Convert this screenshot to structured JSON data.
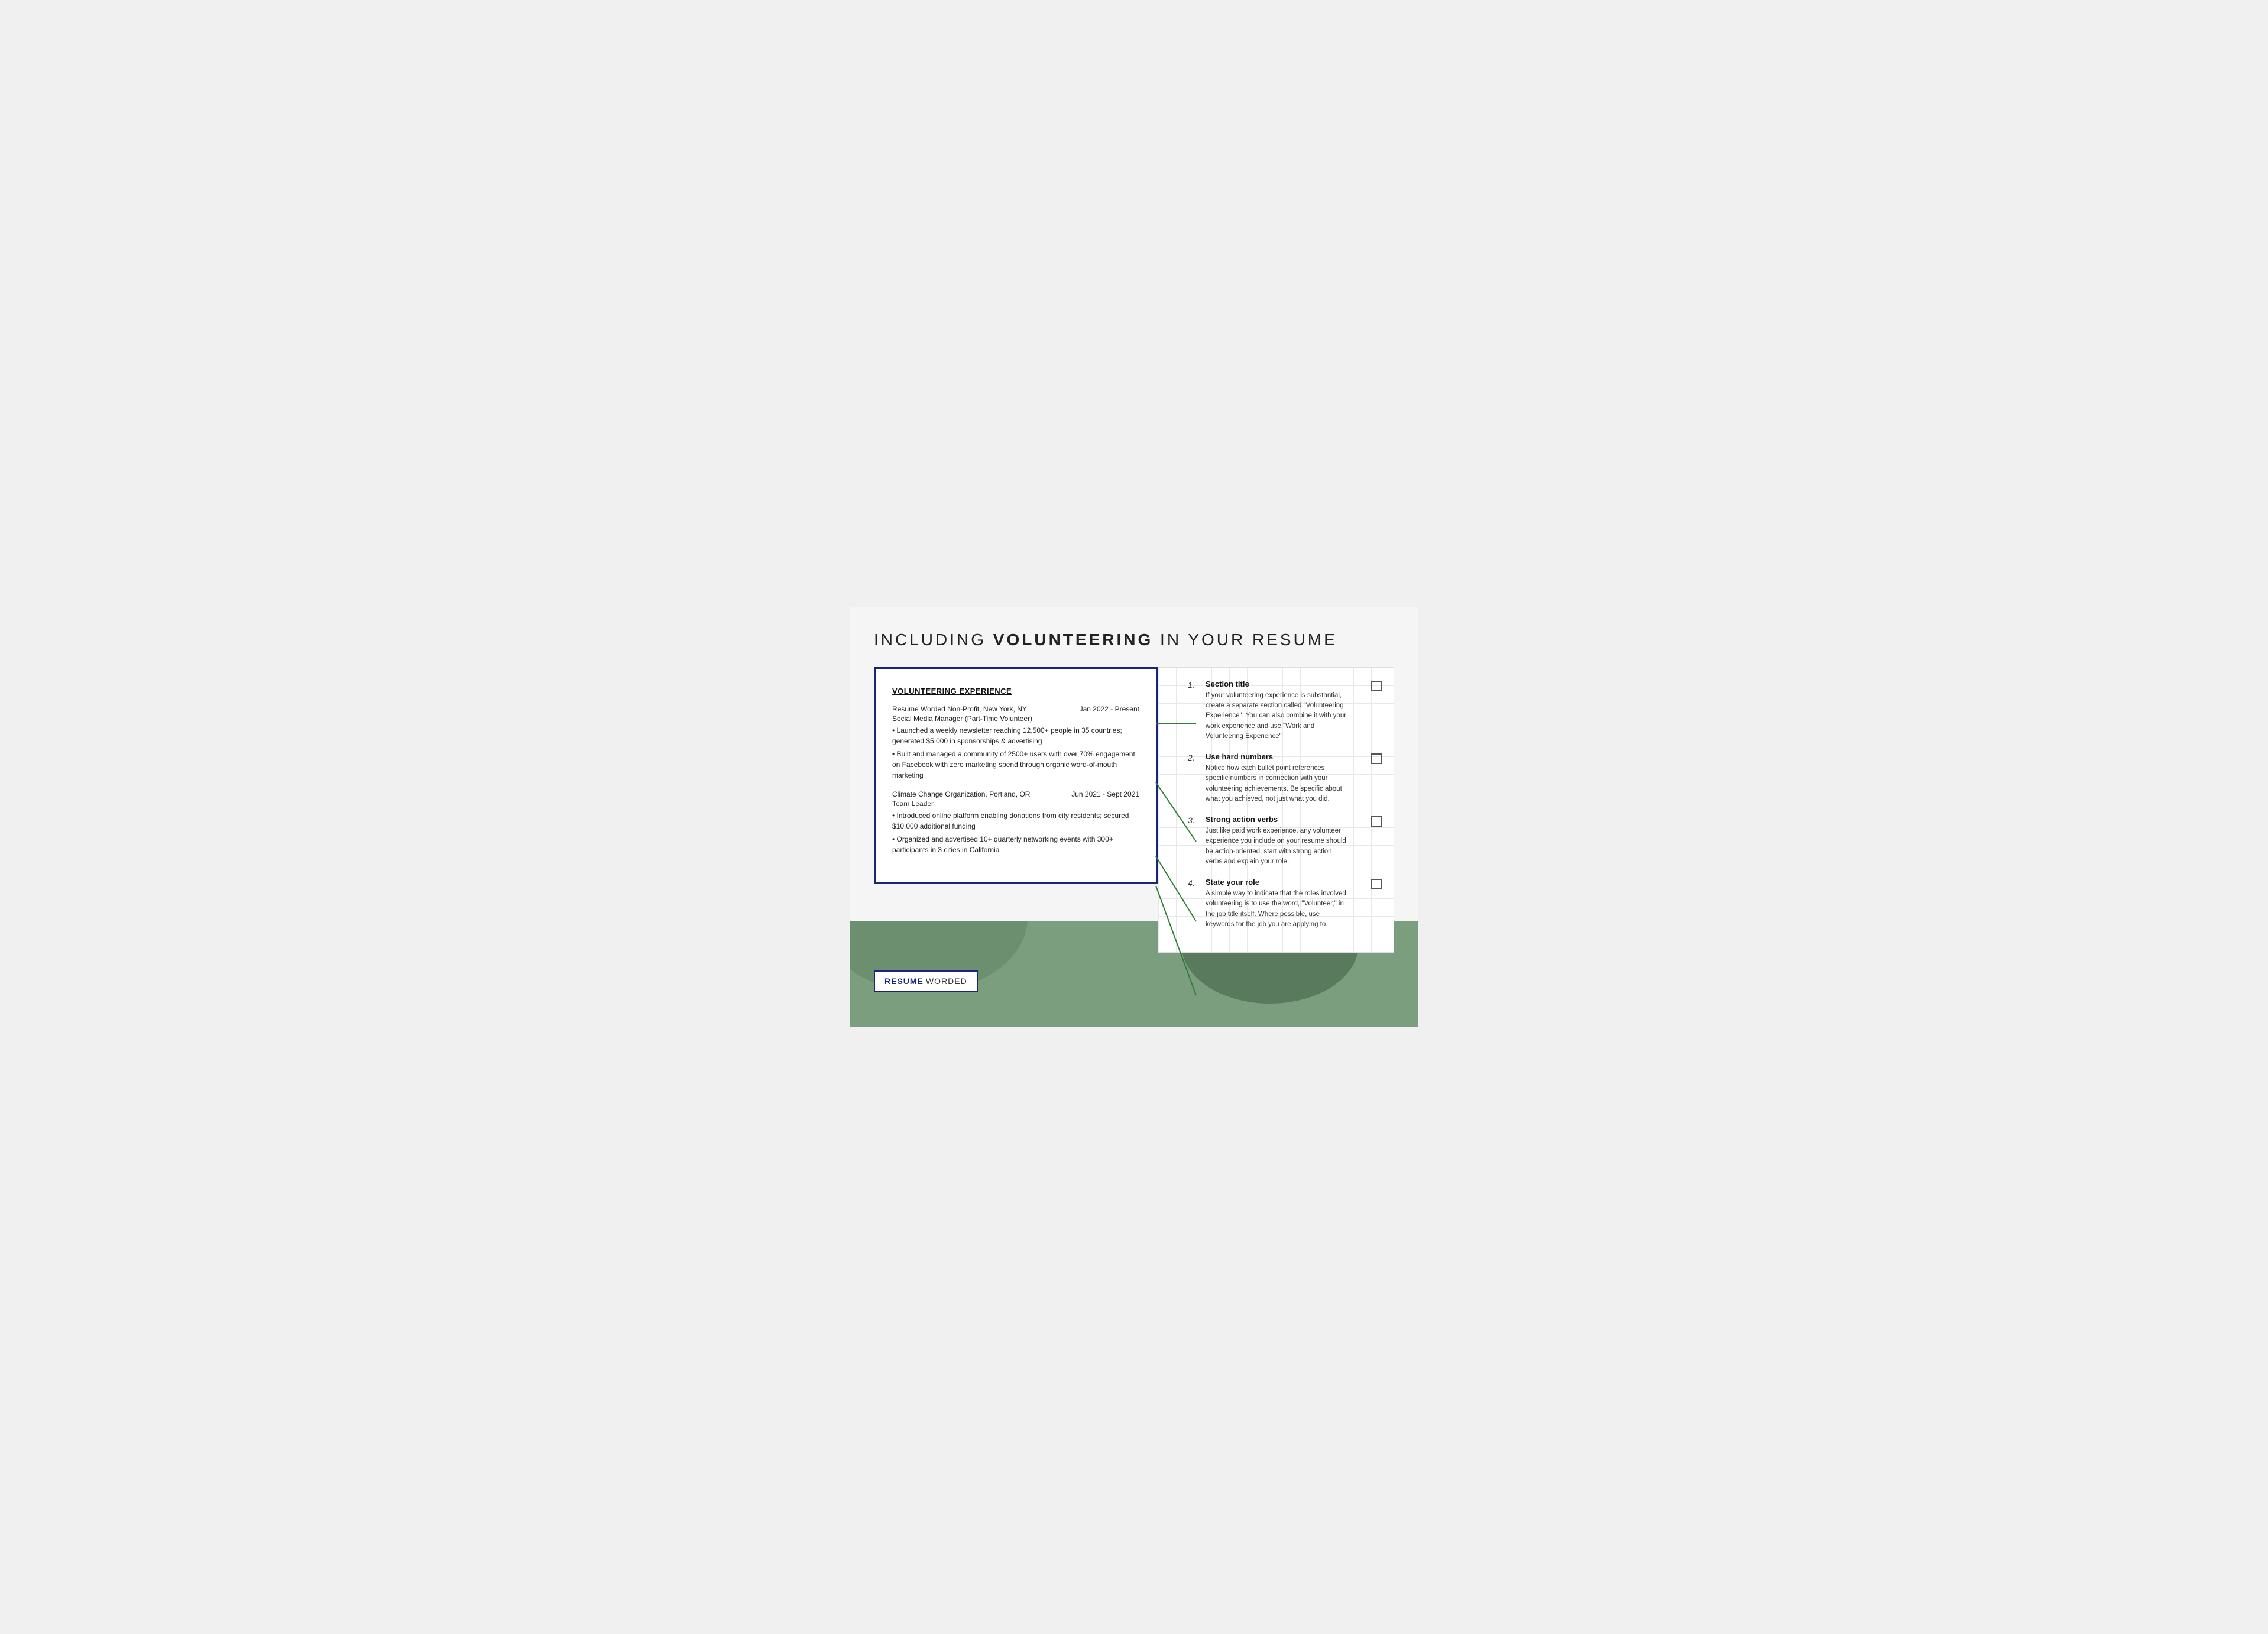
{
  "title": {
    "prefix": "INCLUDING ",
    "bold": "VOLUNTEERING",
    "suffix": " IN YOUR RESUME"
  },
  "resume": {
    "section_title": "VOLUNTEERING EXPERIENCE",
    "entries": [
      {
        "org": "Resume Worded Non-Profit, New York, NY",
        "date": "Jan 2022 - Present",
        "role": "Social Media Manager (Part-Time Volunteer)",
        "bullets": [
          "• Launched a weekly newsletter reaching 12,500+ people in 35 countries; generated $5,000 in sponsorships & advertising",
          "• Built and managed a community of 2500+ users with over 70% engagement on Facebook with zero marketing spend through organic word-of-mouth marketing"
        ]
      },
      {
        "org": "Climate Change Organization, Portland, OR",
        "date": "Jun 2021 - Sept 2021",
        "role": "Team Leader",
        "bullets": [
          "• Introduced online platform enabling donations from city residents; secured $10,000 additional funding",
          "• Organized and advertised 10+ quarterly networking events with 300+ participants in 3 cities in California"
        ]
      }
    ]
  },
  "tips": [
    {
      "number": "1.",
      "title": "Section title",
      "text": "If your volunteering experience is substantial, create a separate section called \"Volunteering Experience\". You can also combine it with your work experience and use \"Work and Volunteering Experience\""
    },
    {
      "number": "2.",
      "title": "Use hard numbers",
      "text": "Notice how each bullet point references specific numbers in connection with your volunteering achievements. Be specific about what you achieved, not just what you did."
    },
    {
      "number": "3.",
      "title": "Strong action verbs",
      "text": "Just like paid work experience, any volunteer experience you include on your resume should be action-oriented, start with strong action verbs and explain your role."
    },
    {
      "number": "4.",
      "title": "State your role",
      "text": "A simple way to indicate that the roles involved volunteering is to use the word, \"Volunteer,\" in the job title itself. Where possible, use keywords for the job you are applying to."
    }
  ],
  "logo": {
    "resume": "RESUME",
    "worded": "WORDED"
  },
  "colors": {
    "dark_blue": "#1a237e",
    "green": "#2e7d32",
    "green_bg": "#7a9e7e"
  }
}
